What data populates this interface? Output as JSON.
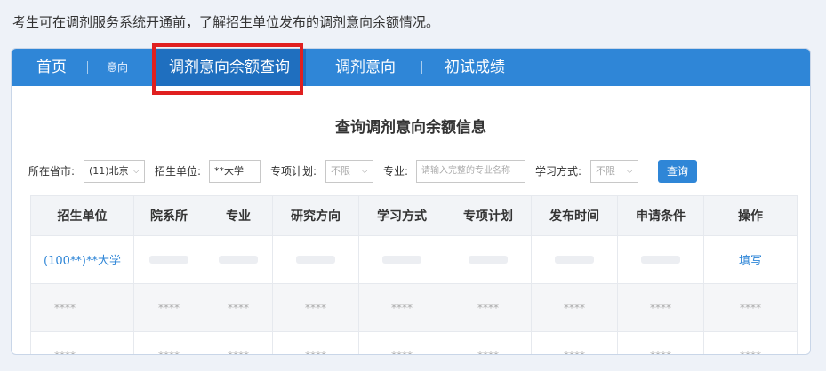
{
  "intro": "考生可在调剂服务系统开通前，了解招生单位发布的调剂意向余额情况。",
  "nav": {
    "home": "首页",
    "intent_small": "意向",
    "balance_query": "调剂意向余额查询",
    "intent": "调剂意向",
    "prelim": "初试成绩"
  },
  "title": "查询调剂意向余额信息",
  "filters": {
    "province_label": "所在省市:",
    "province_value": "(11)北京",
    "unit_label": "招生单位:",
    "unit_value": "**大学",
    "special_label": "专项计划:",
    "special_value": "不限",
    "major_label": "专业:",
    "major_placeholder": "请输入完整的专业名称",
    "mode_label": "学习方式:",
    "mode_value": "不限",
    "query_button": "查询"
  },
  "table": {
    "headers": [
      "招生单位",
      "院系所",
      "专业",
      "研究方向",
      "学习方式",
      "专项计划",
      "发布时间",
      "申请条件",
      "操作"
    ],
    "row1": {
      "unit": "(100**)**大学",
      "action": "填写"
    },
    "masked": "****"
  },
  "colors": {
    "primary": "#2f86d7",
    "highlight": "#e02020"
  }
}
